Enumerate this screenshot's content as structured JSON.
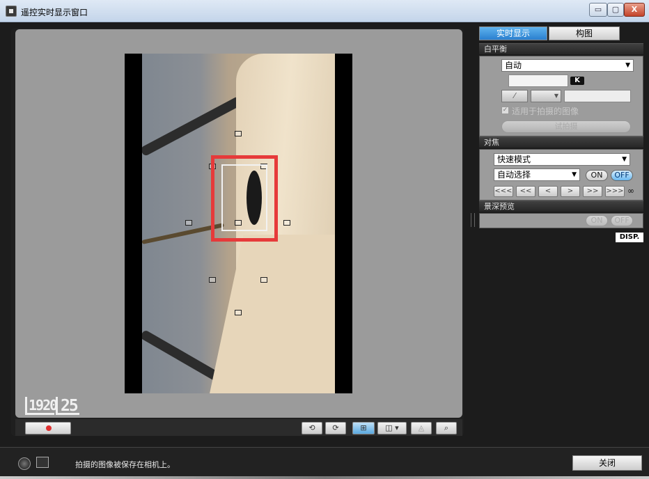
{
  "window": {
    "title": "遥控实时显示窗口",
    "minimize_label": "▭",
    "maximize_label": "▢",
    "close_label": "X"
  },
  "viewer": {
    "badge_resolution": "1920",
    "badge_fps": "25"
  },
  "toolbar": {
    "rotate_left": "⟲",
    "rotate_right": "⟳",
    "grid_label": "⊞",
    "frame_label": "◫ ▾",
    "histogram_label": "◬",
    "zoom_label": "⌕"
  },
  "tabs": {
    "live": "实时显示",
    "composition": "构图"
  },
  "white_balance": {
    "title": "白平衡",
    "mode": "自动",
    "kelvin_value": "",
    "k_label": "K",
    "eyedropper": "⁄",
    "dropdown_value": "",
    "custom_value": "",
    "apply_label": "适用于拍摄的图像",
    "test_shot": "试拍摄"
  },
  "focus": {
    "title": "对焦",
    "mode": "快速模式",
    "af_select": "自动选择",
    "on": "ON",
    "off": "OFF",
    "nav": [
      "<<<",
      "<<",
      "<",
      ">",
      ">>",
      ">>>"
    ],
    "infinity": "∞"
  },
  "dof": {
    "title": "景深预览",
    "on": "ON",
    "off": "OFF"
  },
  "disp_label": "DISP.",
  "status": {
    "message": "拍摄的图像被保存在相机上。",
    "close_button": "关闭"
  },
  "colors": {
    "accent": "#2a7fcf",
    "af_frame_red": "#e63a3a",
    "record_red": "#e03030"
  }
}
